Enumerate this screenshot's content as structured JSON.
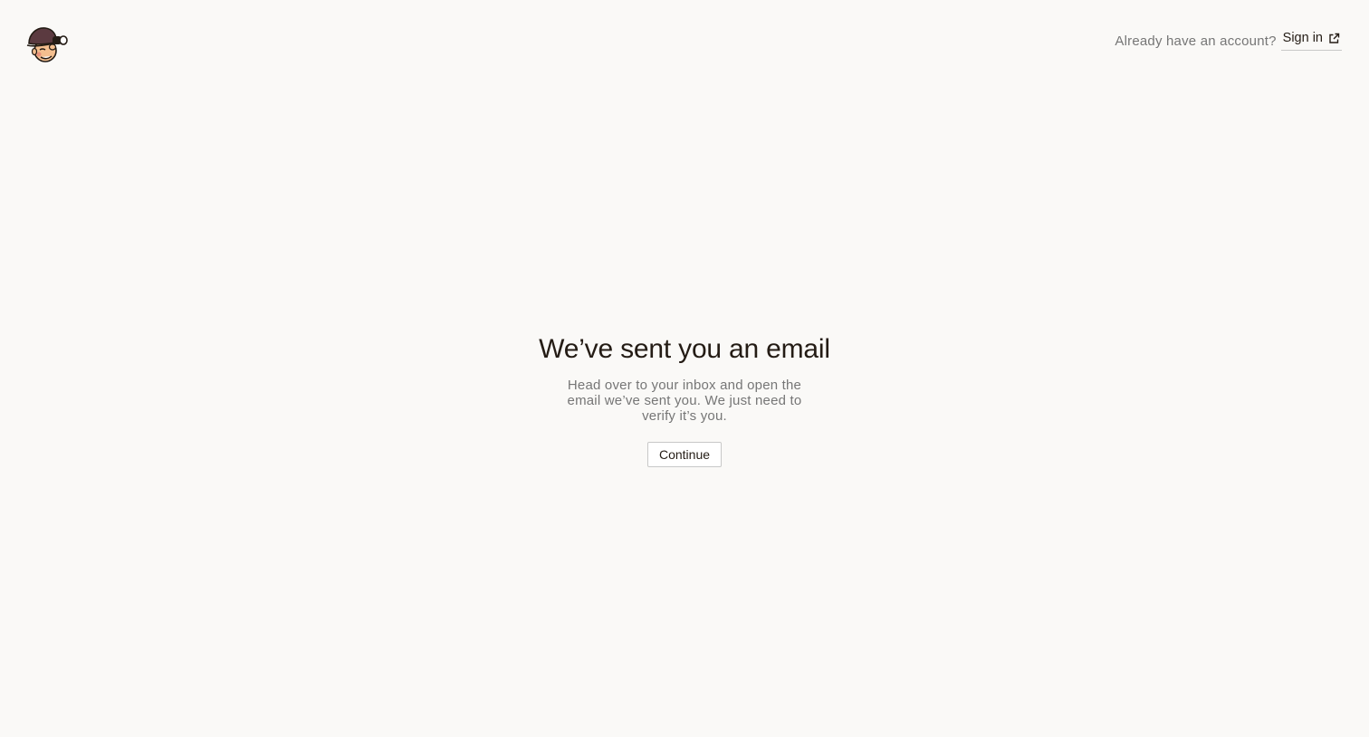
{
  "header": {
    "logo_icon": "mailchimp-freddie-logo-icon",
    "question": "Already have an account?",
    "signin_label": "Sign in",
    "signin_icon": "external-link-icon"
  },
  "main": {
    "title": "We’ve sent you an email",
    "subtitle": "Head over to your inbox and open the email we’ve sent you. We just need to verify it’s you.",
    "continue_label": "Continue"
  },
  "colors": {
    "background": "#faf9f7",
    "text_primary": "#241c15",
    "text_secondary": "#767676",
    "border": "#c8c8c8"
  }
}
